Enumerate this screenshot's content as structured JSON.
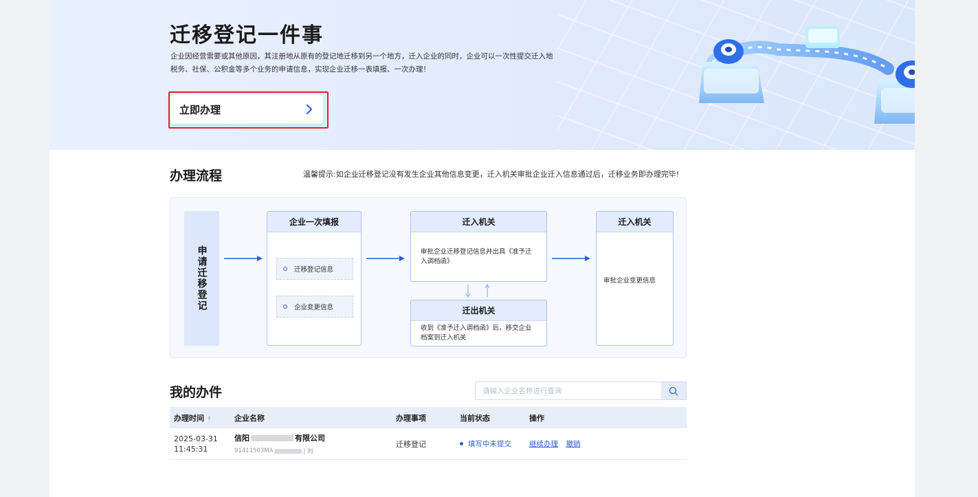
{
  "banner": {
    "title": "迁移登记一件事",
    "desc_line1": "企业因经营需要或其他原因，其注册地从原有的登记地迁移到另一个地方，迁入企业的同时，企业可以一次性提交迁入地",
    "desc_line2": "税务、社保、公积金等多个业务的申请信息，实现企业迁移一表填报、一次办理！",
    "cta_label": "立即办理"
  },
  "process": {
    "title": "办理流程",
    "tip": "温馨提示:如企业迁移登记没有发生企业其他信息变更，迁入机关审批企业迁入信息通过后，迁移业务即办理完毕!",
    "apply_label": "申请迁移登记",
    "step1": {
      "title": "企业一次填报",
      "items": [
        "迁移登记信息",
        "企业变更信息"
      ]
    },
    "step2": {
      "title": "迁入机关",
      "desc": "审批企业迁移登记信息并出具《准予迁入调档函》"
    },
    "step3": {
      "title": "迁出机关",
      "desc": "收到《准予迁入调档函》后，移交企业档案到迁入机关"
    },
    "step4": {
      "title": "迁入机关",
      "desc": "审批企业变更信息"
    }
  },
  "my_items": {
    "title": "我的办件",
    "search_placeholder": "请输入企业名称进行查询",
    "columns": [
      "办理时间",
      "企业名称",
      "办理事项",
      "当前状态",
      "操作"
    ],
    "rows": [
      {
        "date": "2025-03-31",
        "time": "11:45:31",
        "name_prefix": "信阳",
        "name_suffix": "有限公司",
        "code_prefix": "91411503MA",
        "code_suffix": "| 刘",
        "item": "迁移登记",
        "status": "填写中未提交",
        "actions": [
          "继续办理",
          "撤销"
        ]
      }
    ]
  },
  "colors": {
    "accent": "#2f5fd0",
    "highlight_border": "#e02424",
    "banner_bg": "#e3ecfd"
  },
  "icons": {
    "cta": "chevron-right-icon",
    "search": "search-icon",
    "sort": "sort-icon"
  }
}
